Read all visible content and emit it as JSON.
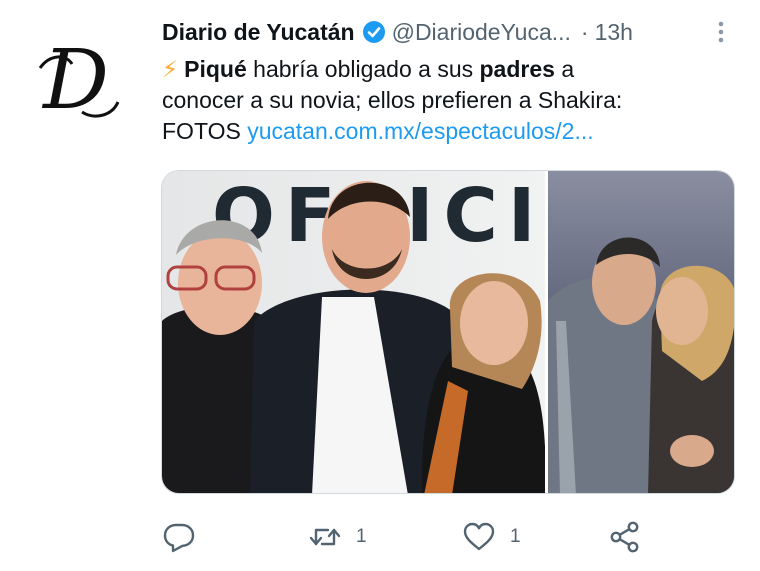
{
  "tweet": {
    "display_name": "Diario de Yucatán",
    "handle": "@DiariodeYuca...",
    "separator": "·",
    "time": "13h",
    "avatar_letter": "D",
    "text": {
      "emoji": "⚡",
      "w1": "Piqué",
      "w2": " habría obligado a sus ",
      "w3": "padres",
      "w4": " a",
      "line2": "conocer a su novia; ellos prefieren a Shakira:",
      "line3_start": "FOTOS ",
      "link": "yucatan.com.mx/espectaculos/2..."
    },
    "media": {
      "backdrop_text": "OFFICIAL"
    },
    "actions": {
      "retweet_count": "1",
      "like_count": "1"
    }
  },
  "colors": {
    "link": "#1d9bf0",
    "verified": "#1d9bf0",
    "muted": "#536471"
  },
  "icons": [
    "more-icon",
    "verified-icon",
    "reply-icon",
    "retweet-icon",
    "like-icon",
    "share-icon"
  ]
}
